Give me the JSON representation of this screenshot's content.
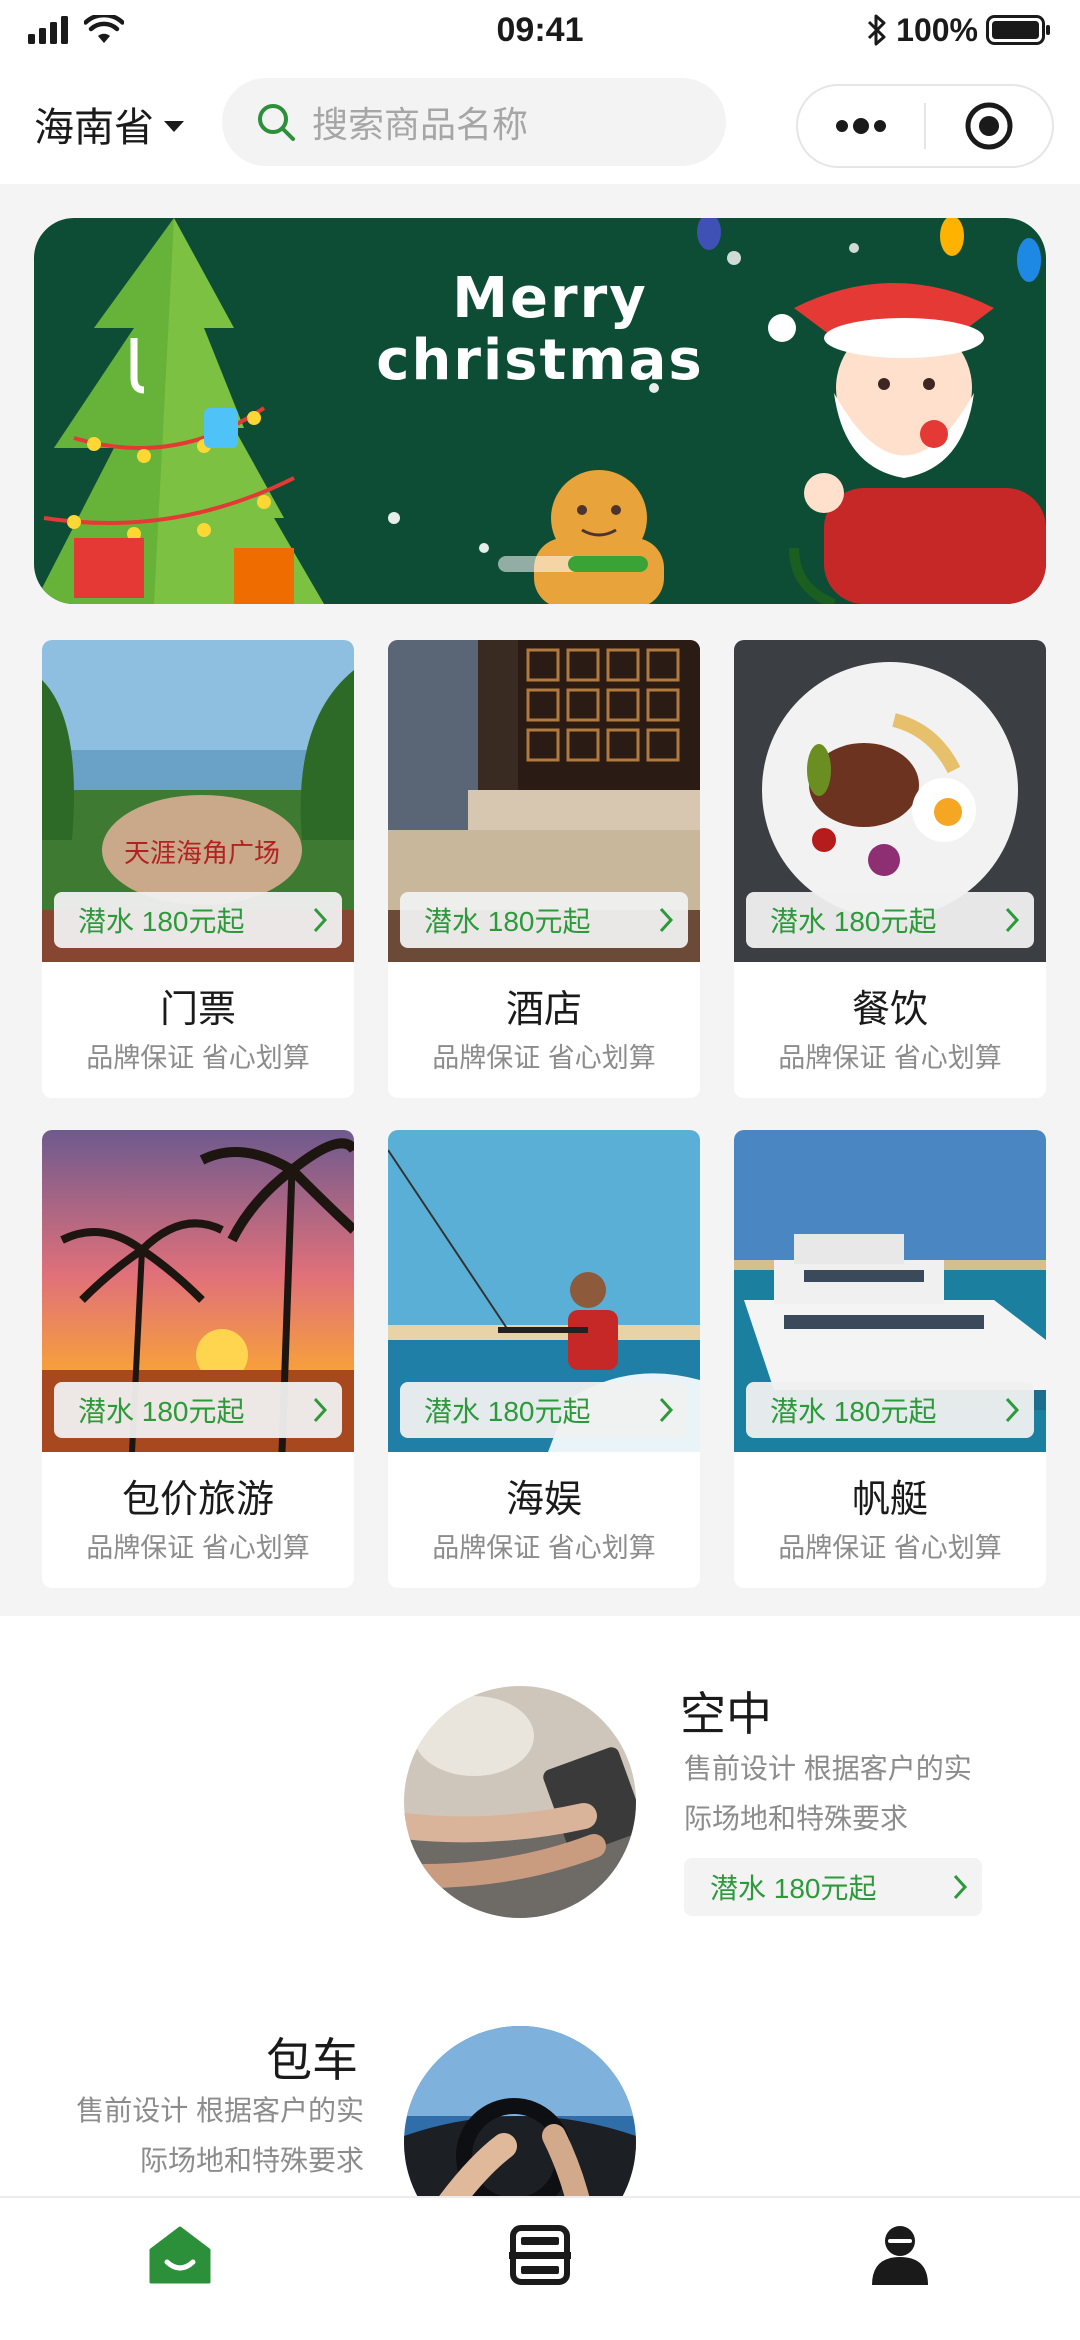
{
  "status_bar": {
    "time": "09:41",
    "battery": "100%"
  },
  "header": {
    "region": "海南省",
    "search_placeholder": "搜索商品名称"
  },
  "banner": {
    "line1": "Merry",
    "line2": "christmas"
  },
  "categories": [
    {
      "title": "门票",
      "subtitle": "品牌保证 省心划算",
      "tag": "潜水 180元起"
    },
    {
      "title": "酒店",
      "subtitle": "品牌保证 省心划算",
      "tag": "潜水 180元起"
    },
    {
      "title": "餐饮",
      "subtitle": "品牌保证 省心划算",
      "tag": "潜水 180元起"
    },
    {
      "title": "包价旅游",
      "subtitle": "品牌保证 省心划算",
      "tag": "潜水 180元起"
    },
    {
      "title": "海娱",
      "subtitle": "品牌保证 省心划算",
      "tag": "潜水 180元起"
    },
    {
      "title": "帆艇",
      "subtitle": "品牌保证 省心划算",
      "tag": "潜水 180元起"
    }
  ],
  "featured": [
    {
      "title": "空中",
      "desc_line1": "售前设计 根据客户的实",
      "desc_line2": "际场地和特殊要求",
      "tag": "潜水 180元起"
    },
    {
      "title": "包车",
      "desc_line1": "售前设计 根据客户的实",
      "desc_line2": "际场地和特殊要求"
    }
  ],
  "tabbar": {
    "items": [
      "home-icon",
      "scan-icon",
      "user-icon"
    ],
    "active_color": "#2c8f3a",
    "inactive_color": "#1a1a1a"
  },
  "colors": {
    "accent": "#2c9a3a",
    "banner_bg": "#0e4d35",
    "page_bg": "#f4f4f4"
  }
}
